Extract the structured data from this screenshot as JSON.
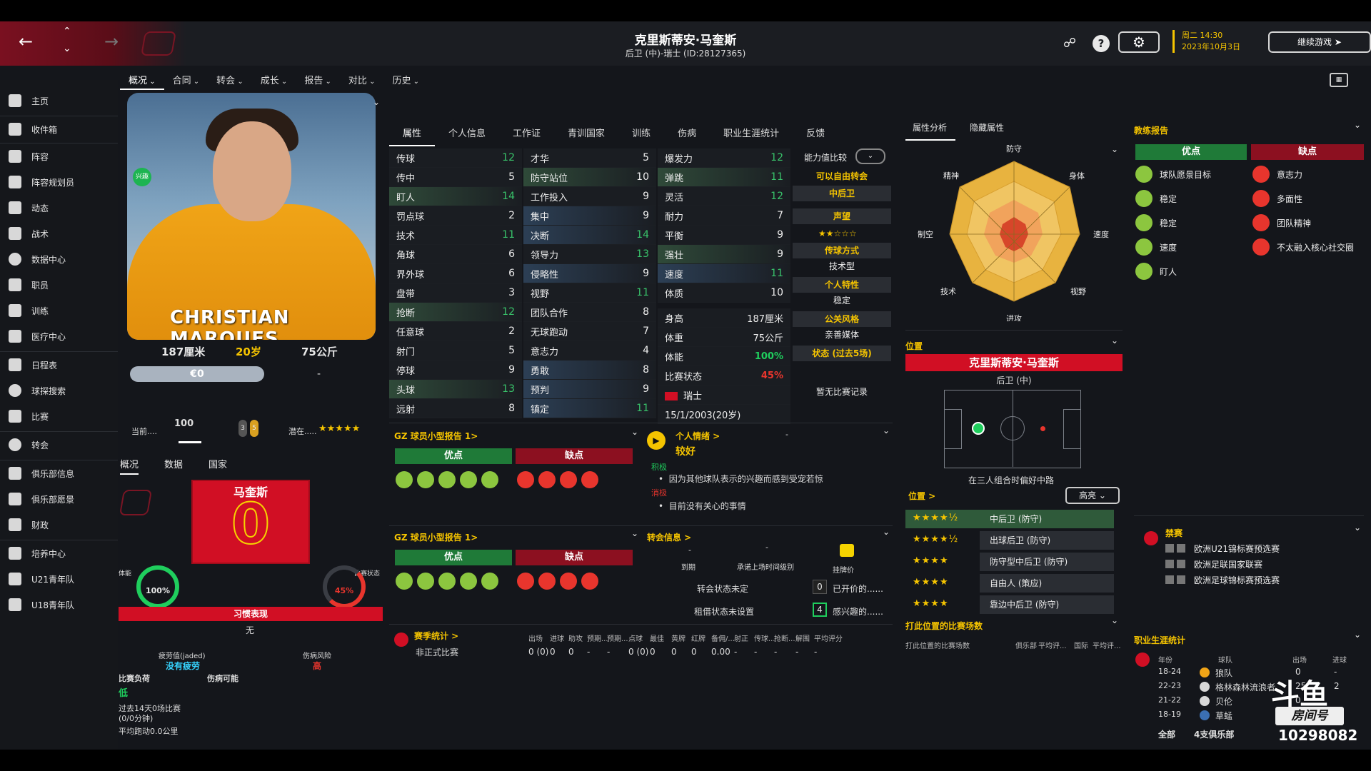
{
  "header": {
    "player_name": "克里斯蒂安·马奎斯",
    "subtitle": "后卫 (中)-瑞士 (ID:28127365)",
    "date_day": "周二 14:30",
    "date": "2023年10月3日",
    "continue_label": "继续游戏"
  },
  "menu": [
    "概况",
    "合同",
    "转会",
    "成长",
    "报告",
    "对比",
    "历史"
  ],
  "sidebar": [
    "主页",
    "收件箱",
    "阵容",
    "阵容规划员",
    "动态",
    "战术",
    "数据中心",
    "职员",
    "训练",
    "医疗中心",
    "日程表",
    "球探搜索",
    "比赛",
    "转会",
    "俱乐部信息",
    "俱乐部愿景",
    "财政",
    "培养中心",
    "U21青年队",
    "U18青年队"
  ],
  "profile": {
    "photo_name": "CHRISTIAN MARQUES",
    "badge": "兴趣",
    "height": "187厘米",
    "age": "20岁",
    "weight": "75公斤",
    "value": "€0",
    "dash": "-",
    "current_label": "当前....",
    "current_value": "100",
    "potential_label": "潜在.....",
    "potential_stars": "★★★★★",
    "subtabs": [
      "概况",
      "数据",
      "国家"
    ],
    "shirt_name": "马奎斯",
    "shirt_number": "0",
    "fitness_label": "体能",
    "fitness_value": "100%",
    "match_label": "比赛状态",
    "match_value": "45%",
    "habit_label": "习惯表现",
    "habit_value": "无",
    "fatigue_label": "疲劳值(jaded)",
    "fatigue_value": "没有疲劳",
    "injury_label": "伤病风险",
    "injury_value": "高",
    "load_label": "比赛负荷",
    "load_value": "低",
    "injury_poss": "伤病可能",
    "recent1": "过去14天0场比赛",
    "recent2": "(0/0分钟)",
    "recent3": "平均跑动0.0公里"
  },
  "tabs": [
    "属性",
    "个人信息",
    "工作证",
    "青训国家",
    "训练",
    "伤病",
    "职业生涯统计",
    "反馈"
  ],
  "attributes": {
    "technical": [
      {
        "n": "传球",
        "v": "12",
        "c": "green"
      },
      {
        "n": "传中",
        "v": "5",
        "c": "white"
      },
      {
        "n": "盯人",
        "v": "14",
        "c": "green"
      },
      {
        "n": "罚点球",
        "v": "2",
        "c": "white"
      },
      {
        "n": "技术",
        "v": "11",
        "c": "green"
      },
      {
        "n": "角球",
        "v": "6",
        "c": "white"
      },
      {
        "n": "界外球",
        "v": "6",
        "c": "white"
      },
      {
        "n": "盘带",
        "v": "3",
        "c": "white"
      },
      {
        "n": "抢断",
        "v": "12",
        "c": "green"
      },
      {
        "n": "任意球",
        "v": "2",
        "c": "white"
      },
      {
        "n": "射门",
        "v": "5",
        "c": "white"
      },
      {
        "n": "停球",
        "v": "9",
        "c": "white"
      },
      {
        "n": "头球",
        "v": "13",
        "c": "green"
      },
      {
        "n": "远射",
        "v": "8",
        "c": "white"
      }
    ],
    "mental": [
      {
        "n": "才华",
        "v": "5",
        "c": "white"
      },
      {
        "n": "防守站位",
        "v": "10",
        "c": "white"
      },
      {
        "n": "工作投入",
        "v": "9",
        "c": "white"
      },
      {
        "n": "集中",
        "v": "9",
        "c": "white"
      },
      {
        "n": "决断",
        "v": "14",
        "c": "green"
      },
      {
        "n": "领导力",
        "v": "13",
        "c": "green"
      },
      {
        "n": "侵略性",
        "v": "9",
        "c": "white"
      },
      {
        "n": "视野",
        "v": "11",
        "c": "green"
      },
      {
        "n": "团队合作",
        "v": "8",
        "c": "white"
      },
      {
        "n": "无球跑动",
        "v": "7",
        "c": "white"
      },
      {
        "n": "意志力",
        "v": "4",
        "c": "white"
      },
      {
        "n": "勇敢",
        "v": "8",
        "c": "white"
      },
      {
        "n": "预判",
        "v": "9",
        "c": "white"
      },
      {
        "n": "镇定",
        "v": "11",
        "c": "green"
      }
    ],
    "physical": [
      {
        "n": "爆发力",
        "v": "12",
        "c": "green"
      },
      {
        "n": "弹跳",
        "v": "11",
        "c": "green"
      },
      {
        "n": "灵活",
        "v": "12",
        "c": "green"
      },
      {
        "n": "耐力",
        "v": "7",
        "c": "white"
      },
      {
        "n": "平衡",
        "v": "9",
        "c": "white"
      },
      {
        "n": "强壮",
        "v": "9",
        "c": "white"
      },
      {
        "n": "速度",
        "v": "11",
        "c": "green"
      },
      {
        "n": "体质",
        "v": "10",
        "c": "white"
      }
    ],
    "info": [
      {
        "n": "身高",
        "v": "187厘米"
      },
      {
        "n": "体重",
        "v": "75公斤"
      },
      {
        "n": "体能",
        "v": "100%"
      },
      {
        "n": "比赛状态",
        "v": "45%"
      }
    ],
    "nation": "瑞士",
    "dob": "15/1/2003(20岁)"
  },
  "ability": {
    "compare_label": "能力值比较",
    "free_transfer": "可以自由转会",
    "position": "中后卫",
    "reputation_label": "声望",
    "passing_style_label": "传球方式",
    "passing_style": "技术型",
    "trait_label": "个人特性",
    "trait": "稳定",
    "pr_label": "公关风格",
    "pr": "亲善媒体",
    "form_label": "状态 (过去5场)",
    "form": "暂无比赛记录"
  },
  "scout1": {
    "title": "GZ 球员小型报告 1>",
    "pros": "优点",
    "cons": "缺点"
  },
  "scout2": {
    "title": "GZ 球员小型报告 1>",
    "pros": "优点",
    "cons": "缺点"
  },
  "mood": {
    "title": "个人情绪 >",
    "value": "较好",
    "dash": "-",
    "pos_label": "积极",
    "pos_item": "因为其他球队表示的兴趣而感到受宠若惊",
    "neg_label": "消极",
    "neg_item": "目前没有关心的事情"
  },
  "transfer": {
    "title": "转会信息 >",
    "d1": "-",
    "d2": "-",
    "expire": "到期",
    "next_level": "承诺上场时间级别",
    "listing": "挂牌价",
    "status": "转会状态未定",
    "loan": "租借状态未设置",
    "offers_n": "0",
    "offers": "已开价的......",
    "interest_n": "4",
    "interest": "感兴趣的......"
  },
  "season": {
    "title": "赛季统计 >",
    "headers": [
      "出场",
      "进球",
      "助攻",
      "预期...",
      "预期...",
      "点球",
      "最佳",
      "黄牌",
      "红牌",
      "备佣/...",
      "射正",
      "传球...",
      "抢断...",
      "解围",
      "平均评分"
    ],
    "row_label": "非正式比赛",
    "row": [
      "0 (0)",
      "0",
      "0",
      "-",
      "-",
      "0 (0)",
      "0",
      "0",
      "0",
      "0.00",
      "-",
      "-",
      "-",
      "-",
      "-"
    ]
  },
  "analysis": {
    "tabs": [
      "属性分析",
      "隐藏属性"
    ],
    "labels": [
      "防守",
      "身体",
      "速度",
      "视野",
      "进攻",
      "技术",
      "制空",
      "精神"
    ]
  },
  "position": {
    "title": "位置",
    "name": "克里斯蒂安·马奎斯",
    "pos": "后卫 (中)",
    "note": "在三人组合时偏好中路",
    "roles_title": "位置 >",
    "highlight": "高亮",
    "roles": [
      {
        "stars": "★★★★½",
        "name": "中后卫 (防守)"
      },
      {
        "stars": "★★★★½",
        "name": "出球后卫 (防守)"
      },
      {
        "stars": "★★★★",
        "name": "防守型中后卫 (防守)"
      },
      {
        "stars": "★★★★",
        "name": "自由人 (策应)"
      },
      {
        "stars": "★★★★",
        "name": "靠边中后卫 (防守)"
      }
    ],
    "matches_title": "打此位置的比赛场数",
    "matches_h": [
      "打此位置的比赛场数",
      "俱乐部",
      "平均评...",
      "国际",
      "平均评..."
    ]
  },
  "coach": {
    "title": "教练报告",
    "pros": "优点",
    "cons": "缺点",
    "pros_items": [
      "球队愿景目标",
      "稳定",
      "稳定",
      "速度",
      "盯人"
    ],
    "cons_items": [
      "意志力",
      "多面性",
      "团队精神",
      "不太融入核心社交圈"
    ]
  },
  "bans": {
    "title": "禁赛",
    "items": [
      "欧洲U21锦标赛预选赛",
      "欧洲足联国家联赛",
      "欧洲足球锦标赛预选赛"
    ]
  },
  "career": {
    "title": "职业生涯统计",
    "headers": [
      "年份",
      "球队",
      "出场",
      "进球"
    ],
    "rows": [
      {
        "year": "18-24",
        "team": "狼队",
        "apps": "0",
        "goals": "-"
      },
      {
        "year": "22-23",
        "team": "格林森林流浪者",
        "apps": "25",
        "goals": "2"
      },
      {
        "year": "21-22",
        "team": "贝伦",
        "apps": "0",
        "goals": ""
      },
      {
        "year": "18-19",
        "team": "草蜢",
        "apps": "0",
        "goals": ""
      }
    ],
    "total": "全部",
    "clubs": "4支俱乐部"
  },
  "watermark": {
    "brand": "斗鱼",
    "room": "房间号",
    "id": "10298082"
  }
}
